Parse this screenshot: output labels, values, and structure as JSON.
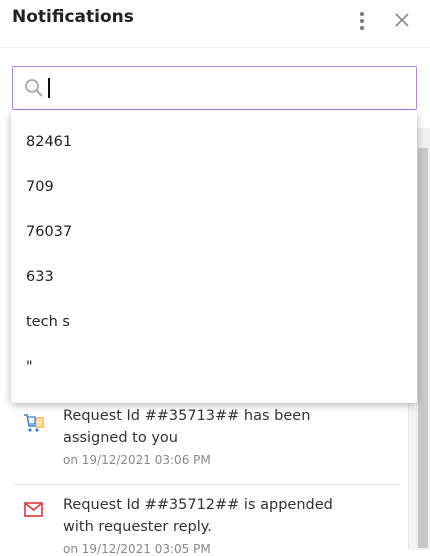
{
  "header": {
    "title": "Notifications"
  },
  "search": {
    "value": "",
    "placeholder": ""
  },
  "suggestions": [
    "82461",
    "709",
    "76037",
    "633",
    "tech s",
    "\""
  ],
  "notifications": [
    {
      "text": "Request Id ##35713## has been assigned to you",
      "time": "on 19/12/2021 03:06 PM",
      "icon": "cart-icon"
    },
    {
      "text": "Request Id ##35712## is appended with requester reply.",
      "time": "on 19/12/2021 03:05 PM",
      "icon": "mail-icon"
    }
  ],
  "colors": {
    "search_border": "#b488d2",
    "cart_icon": "#3b7fd4",
    "cart_accent": "#f5a623",
    "mail_icon": "#e0363b"
  }
}
